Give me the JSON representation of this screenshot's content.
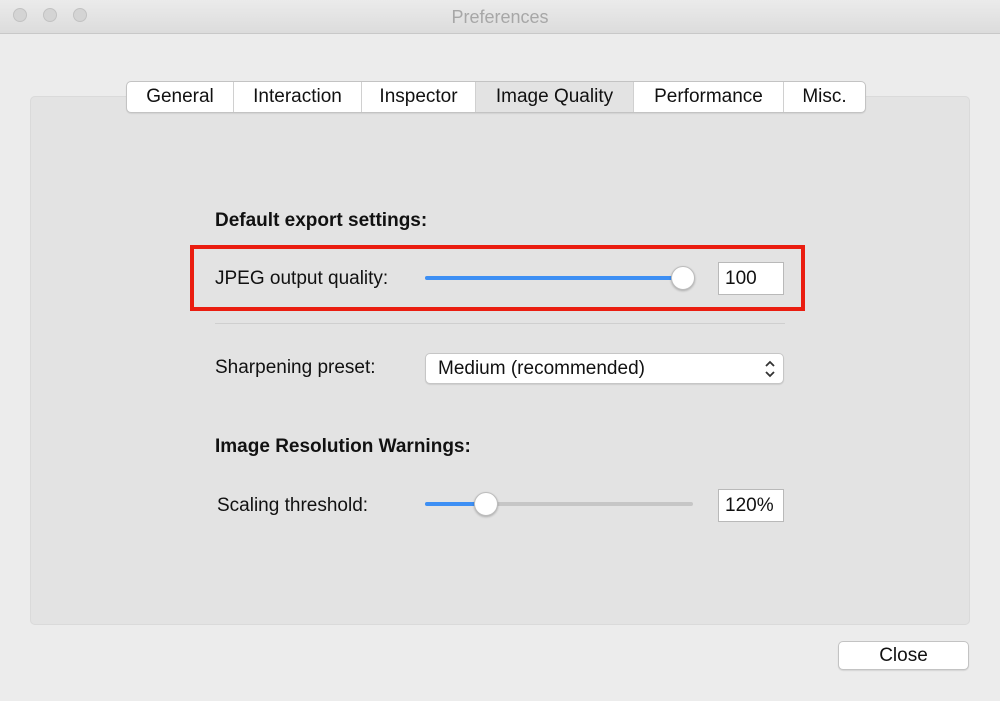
{
  "window": {
    "title": "Preferences"
  },
  "tabs": [
    {
      "label": "General",
      "active": false
    },
    {
      "label": "Interaction",
      "active": false
    },
    {
      "label": "Inspector",
      "active": false
    },
    {
      "label": "Image Quality",
      "active": true
    },
    {
      "label": "Performance",
      "active": false
    },
    {
      "label": "Misc.",
      "active": false
    }
  ],
  "export": {
    "heading": "Default export settings:",
    "jpeg_label": "JPEG output quality:",
    "jpeg_value": "100",
    "jpeg_slider_fraction": 1.0
  },
  "sharpening": {
    "label": "Sharpening preset:",
    "selected": "Medium (recommended)"
  },
  "resolution": {
    "heading": "Image Resolution Warnings:",
    "scaling_label": "Scaling threshold:",
    "scaling_value": "120%",
    "scaling_slider_fraction": 0.2
  },
  "footer": {
    "close_label": "Close"
  },
  "colors": {
    "accent": "#3d8ff4",
    "highlight": "#ea1d10"
  }
}
